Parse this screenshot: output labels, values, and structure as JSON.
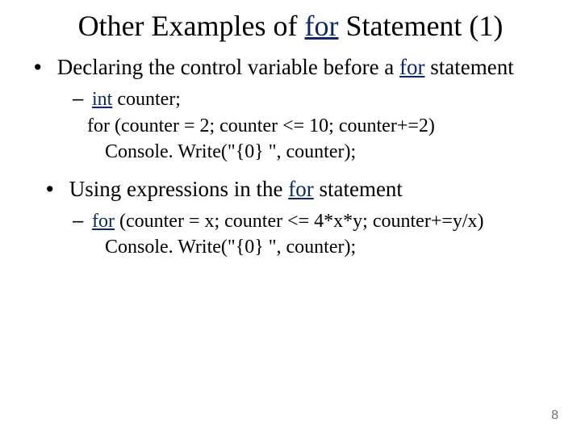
{
  "title": {
    "pre": "Other Examples of ",
    "kw": "for",
    "post": " Statement (1)"
  },
  "section1": {
    "bullet": {
      "pre": "Declaring the control variable before a ",
      "kw": "for",
      "post": " statement"
    },
    "code": {
      "line1_kw": "int",
      "line1_rest": " counter;",
      "line2_kw": "for",
      "line2_rest": " (counter = 2; counter  <= 10; counter+=2)",
      "line3": "Console. Write(\"{0} \", counter);"
    }
  },
  "section2": {
    "bullet": {
      "pre": "Using expressions in the ",
      "kw": "for",
      "post": " statement"
    },
    "code": {
      "line1_kw": "for",
      "line1_rest": " (counter = x; counter  <= 4*x*y; counter+=y/x)",
      "line2": "Console. Write(\"{0} \", counter);"
    }
  },
  "page_number": "8"
}
